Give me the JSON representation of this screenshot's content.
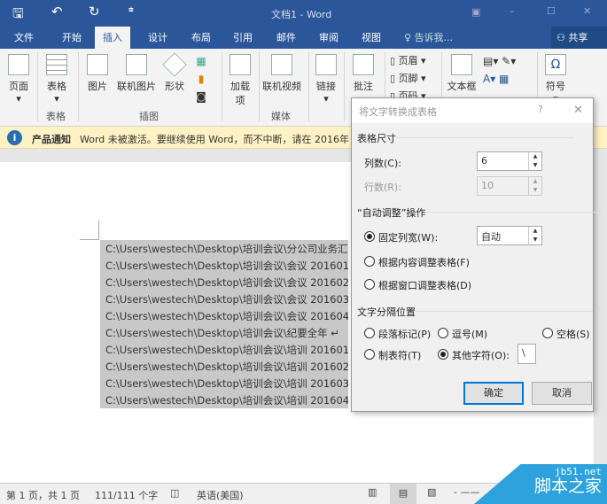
{
  "titlebar": {
    "title": "文档1 - Word",
    "save_icon": "save-icon",
    "undo_icon": "undo-icon",
    "redo_icon": "redo-icon"
  },
  "tabs": [
    {
      "label": "文件"
    },
    {
      "label": "开始"
    },
    {
      "label": "插入",
      "active": true
    },
    {
      "label": "设计"
    },
    {
      "label": "布局"
    },
    {
      "label": "引用"
    },
    {
      "label": "邮件"
    },
    {
      "label": "审阅"
    },
    {
      "label": "视图"
    }
  ],
  "tell_me": "告诉我...",
  "share": "共享",
  "ribbon": {
    "buttons": [
      "页面",
      "表格",
      "图片",
      "联机图片",
      "形状",
      "加载项",
      "联机视频",
      "链接",
      "批注",
      "文本框",
      "符号"
    ],
    "small": [
      "页眉",
      "页脚",
      "页码"
    ],
    "groups": [
      "表格",
      "插图",
      "媒体"
    ]
  },
  "notice": {
    "title": "产品通知",
    "text": "Word 未被激活。要继续使用 Word，而不中断，请在 2016年"
  },
  "document": {
    "lines": [
      "C:\\Users\\westech\\Desktop\\培训会议\\分公司业务汇",
      "C:\\Users\\westech\\Desktop\\培训会议\\会议 201601",
      "C:\\Users\\westech\\Desktop\\培训会议\\会议 201602",
      "C:\\Users\\westech\\Desktop\\培训会议\\会议 201603",
      "C:\\Users\\westech\\Desktop\\培训会议\\会议 201604",
      "C:\\Users\\westech\\Desktop\\培训会议\\纪要全年 ↵",
      "C:\\Users\\westech\\Desktop\\培训会议\\培训 201601",
      "C:\\Users\\westech\\Desktop\\培训会议\\培训 201602",
      "C:\\Users\\westech\\Desktop\\培训会议\\培训 201603",
      "C:\\Users\\westech\\Desktop\\培训会议\\培训 201604"
    ]
  },
  "status": {
    "page": "第 1 页，共 1 页",
    "words": "111/111 个字",
    "language": "英语(美国)"
  },
  "dialog": {
    "title": "将文字转换成表格",
    "help": "?",
    "close": "✕",
    "size_section": "表格尺寸",
    "cols_label": "列数(C):",
    "cols_value": "6",
    "rows_label": "行数(R):",
    "rows_value": "10",
    "autofit_section": "“自动调整”操作",
    "fixed_label": "固定列宽(W):",
    "fixed_value": "自动",
    "fit_content": "根据内容调整表格(F)",
    "fit_window": "根据窗口调整表格(D)",
    "sep_section": "文字分隔位置",
    "sep_para": "段落标记(P)",
    "sep_comma": "逗号(M)",
    "sep_space": "空格(S)",
    "sep_tab": "制表符(T)",
    "sep_other": "其他字符(O):",
    "other_value": "\\",
    "ok": "确定",
    "cancel": "取消"
  },
  "watermark": {
    "site": "jb51.net",
    "name": "脚本之家"
  },
  "colors": {
    "accent": "#2b579a",
    "notice": "#fff2c4",
    "selection": "#c8c8c8",
    "default_button": "#0078d7"
  }
}
